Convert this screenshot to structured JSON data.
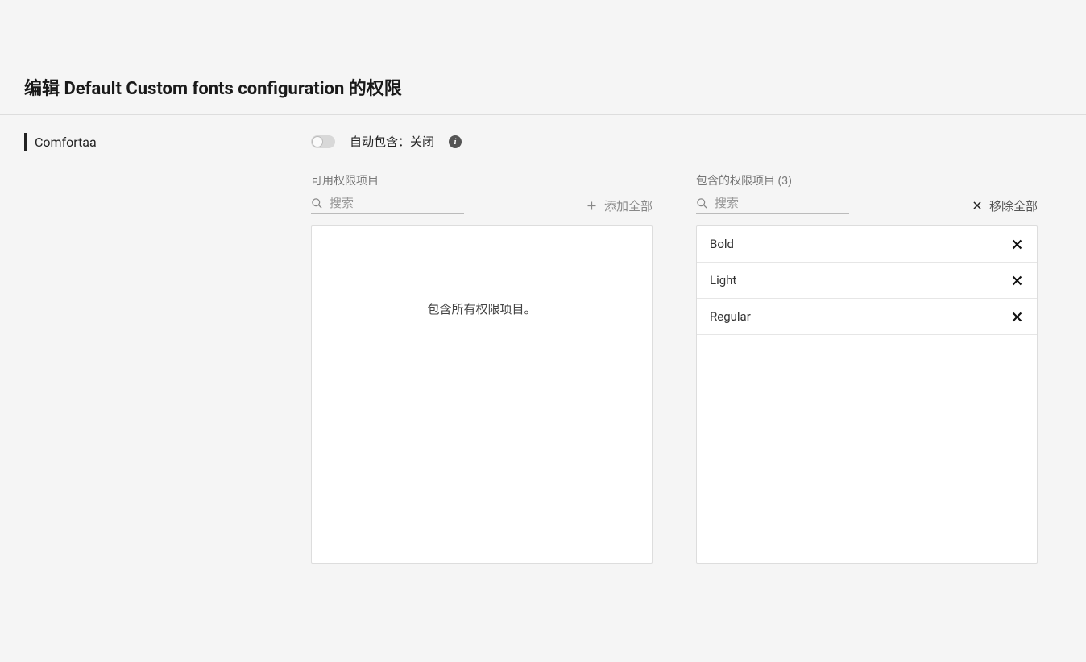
{
  "page": {
    "title": "编辑 Default Custom fonts configuration 的权限"
  },
  "sidebar": {
    "active": "Comfortaa"
  },
  "toggle": {
    "label": "自动包含：关闭",
    "state": "off"
  },
  "available": {
    "header": "可用权限项目",
    "search_placeholder": "搜索",
    "add_all_label": "添加全部",
    "empty_message": "包含所有权限项目。"
  },
  "included": {
    "header": "包含的权限项目 (3)",
    "search_placeholder": "搜索",
    "remove_all_label": "移除全部",
    "items": [
      {
        "label": "Bold"
      },
      {
        "label": "Light"
      },
      {
        "label": "Regular"
      }
    ]
  }
}
